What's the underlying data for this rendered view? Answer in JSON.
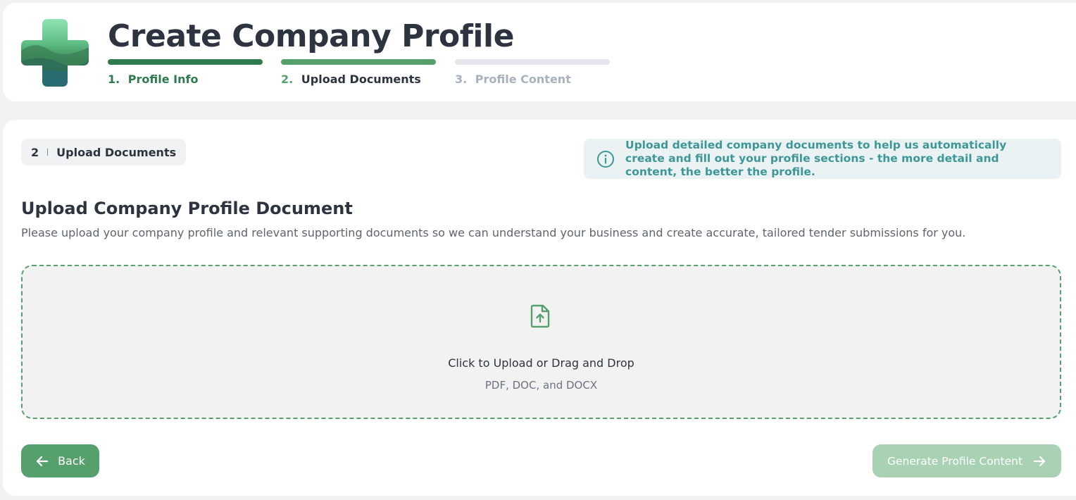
{
  "header": {
    "title": "Create Company Profile",
    "logo_icon": "plus-cross-landscape-logo"
  },
  "stepper": {
    "steps": [
      {
        "number": "1.",
        "label": "Profile Info",
        "state": "completed"
      },
      {
        "number": "2.",
        "label": "Upload Documents",
        "state": "current"
      },
      {
        "number": "3.",
        "label": "Profile Content",
        "state": "upcoming"
      }
    ]
  },
  "main": {
    "step_badge": {
      "number": "2",
      "label": "Upload Documents"
    },
    "info": {
      "icon": "info-icon",
      "text": "Upload detailed company documents to help us automatically create and fill out your profile sections - the more detail and content, the better the profile."
    },
    "section_title": "Upload Company Profile Document",
    "section_description": "Please upload your company profile and relevant supporting documents so we can understand your business and create accurate, tailored tender submissions for you.",
    "dropzone": {
      "icon": "file-upload-icon",
      "title": "Click to Upload or Drag and Drop",
      "subtitle": "PDF, DOC, and DOCX"
    }
  },
  "footer": {
    "back_label": "Back",
    "generate_label": "Generate Profile Content",
    "generate_enabled": false
  },
  "colors": {
    "brand_green": "#55a06c",
    "dark_green": "#2f7a4f",
    "disabled_green": "#a8d2b3",
    "info_teal": "#3d9796",
    "text_dark": "#2d3440"
  }
}
